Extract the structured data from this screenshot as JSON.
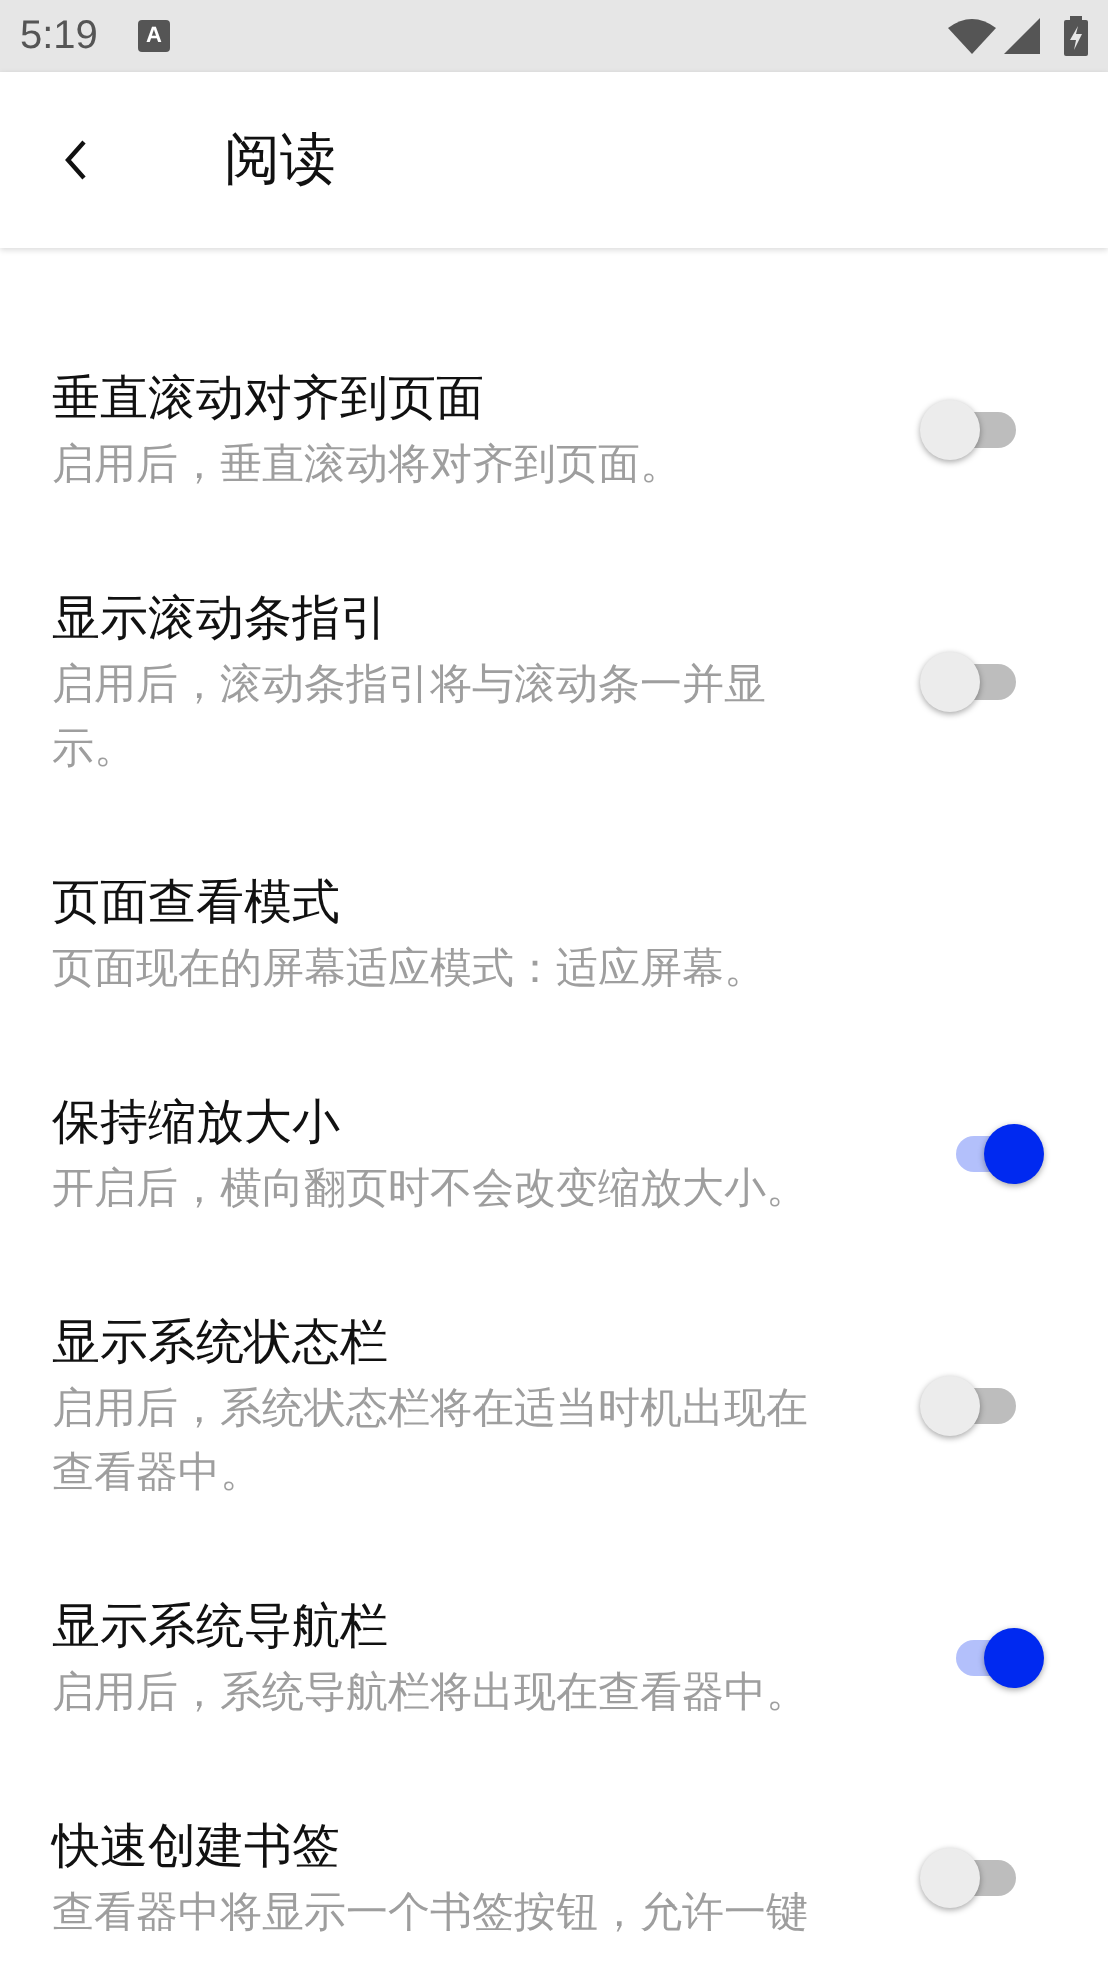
{
  "status_bar": {
    "time": "5:19",
    "notification_letter": "A"
  },
  "app_bar": {
    "title": "阅读"
  },
  "settings": [
    {
      "kind": "switch",
      "title": "垂直滚动对齐到页面",
      "description": "启用后，垂直滚动将对齐到页面。",
      "on": false
    },
    {
      "kind": "switch",
      "title": "显示滚动条指引",
      "description": "启用后，滚动条指引将与滚动条一并显示。",
      "on": false
    },
    {
      "kind": "value",
      "title": "页面查看模式",
      "description": "页面现在的屏幕适应模式：适应屏幕。"
    },
    {
      "kind": "switch",
      "title": "保持缩放大小",
      "description": "开启后，横向翻页时不会改变缩放大小。",
      "on": true
    },
    {
      "kind": "switch",
      "title": "显示系统状态栏",
      "description": "启用后，系统状态栏将在适当时机出现在查看器中。",
      "on": false
    },
    {
      "kind": "switch",
      "title": "显示系统导航栏",
      "description": "启用后，系统导航栏将出现在查看器中。",
      "on": true
    },
    {
      "kind": "switch",
      "title": "快速创建书签",
      "description": "查看器中将显示一个书签按钮，允许一键",
      "on": false
    }
  ]
}
